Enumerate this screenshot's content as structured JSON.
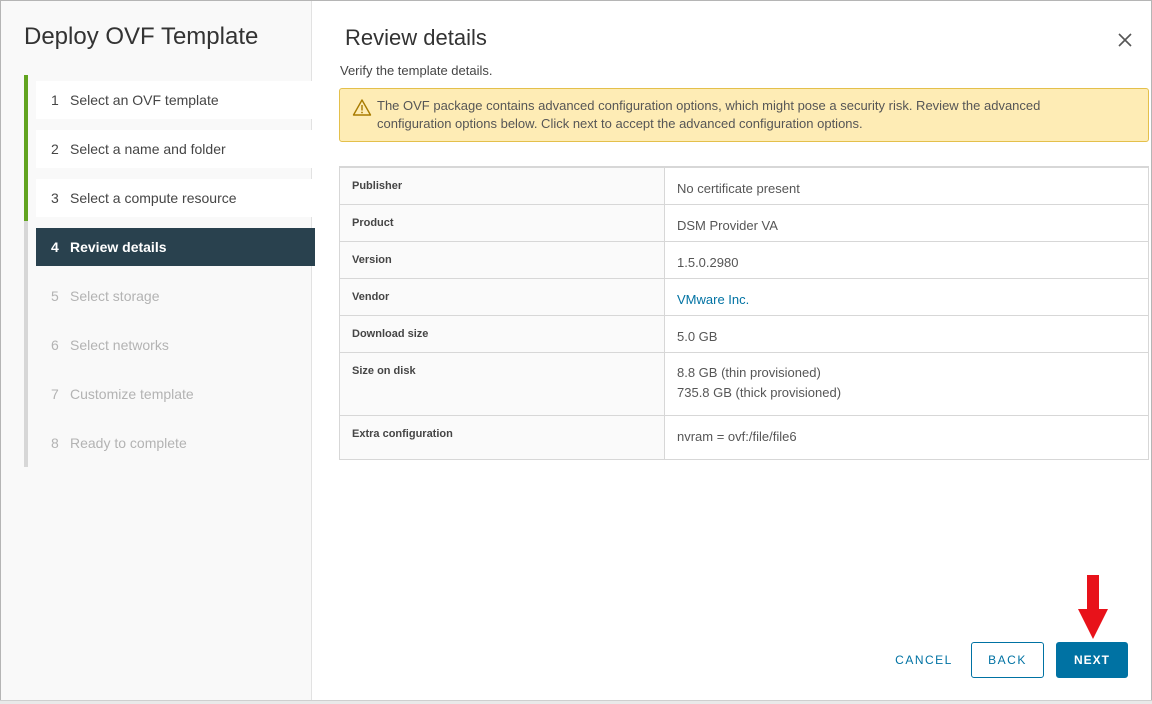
{
  "wizard": {
    "title": "Deploy OVF Template",
    "steps": [
      {
        "num": "1",
        "label": "Select an OVF template"
      },
      {
        "num": "2",
        "label": "Select a name and folder"
      },
      {
        "num": "3",
        "label": "Select a compute resource"
      },
      {
        "num": "4",
        "label": "Review details"
      },
      {
        "num": "5",
        "label": "Select storage"
      },
      {
        "num": "6",
        "label": "Select networks"
      },
      {
        "num": "7",
        "label": "Customize template"
      },
      {
        "num": "8",
        "label": "Ready to complete"
      }
    ],
    "active_step": 4
  },
  "main": {
    "title": "Review details",
    "subtitle": "Verify the template details.",
    "alert": "The OVF package contains advanced configuration options, which might pose a security risk. Review the advanced configuration options below. Click next to accept the advanced configuration options.",
    "details": {
      "publisher_key": "Publisher",
      "publisher_val": "No certificate present",
      "product_key": "Product",
      "product_val": "DSM Provider VA",
      "version_key": "Version",
      "version_val": "1.5.0.2980",
      "vendor_key": "Vendor",
      "vendor_val": "VMware Inc.",
      "download_key": "Download size",
      "download_val": "5.0 GB",
      "disk_key": "Size on disk",
      "disk_val_thin": "8.8 GB (thin provisioned)",
      "disk_val_thick": "735.8 GB (thick provisioned)",
      "extra_key": "Extra configuration",
      "extra_val": "nvram = ovf:/file/file6"
    }
  },
  "footer": {
    "cancel": "CANCEL",
    "back": "BACK",
    "next": "NEXT"
  },
  "colors": {
    "active_step_bg": "#29414e",
    "done_bar": "#62a420",
    "primary": "#0072a3",
    "alert_bg": "#feecb5",
    "annotation_arrow": "#e8121a"
  }
}
